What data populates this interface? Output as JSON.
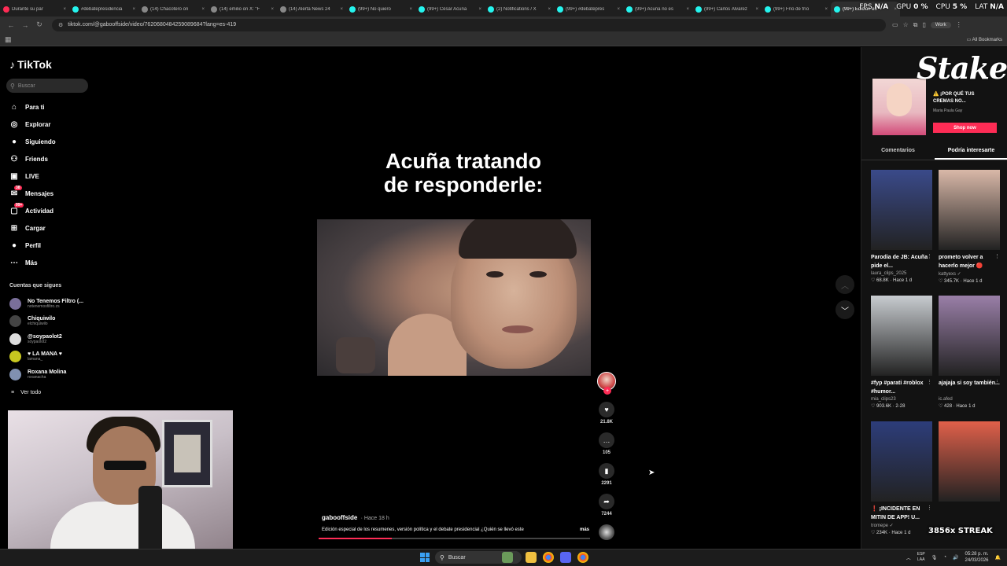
{
  "browser": {
    "tabs": [
      {
        "title": "Durante su par",
        "color": "#fe2c55",
        "icon": "youtube-icon"
      },
      {
        "title": "#debatepresidencia",
        "color": "#25f4ee",
        "icon": "tiktok-icon"
      },
      {
        "title": "(14) Chacotero on",
        "color": "#888888",
        "icon": "x-icon"
      },
      {
        "title": "(14) emilio on X: \"F",
        "color": "#888888",
        "icon": "x-icon"
      },
      {
        "title": "(14) Alerta News 24",
        "color": "#888888",
        "icon": "x-icon"
      },
      {
        "title": "(99+) No quiero",
        "color": "#25f4ee",
        "icon": "tiktok-icon"
      },
      {
        "title": "(99+) César Acuña",
        "color": "#25f4ee",
        "icon": "tiktok-icon"
      },
      {
        "title": "(2) Notifications / X",
        "color": "#25f4ee",
        "icon": "tiktok-icon"
      },
      {
        "title": "(99+) #debatepres",
        "color": "#25f4ee",
        "icon": "tiktok-icon"
      },
      {
        "title": "(99+) Acuña no es",
        "color": "#25f4ee",
        "icon": "tiktok-icon"
      },
      {
        "title": "(99+) Carlos Álvarez",
        "color": "#25f4ee",
        "icon": "tiktok-icon"
      },
      {
        "title": "(99+) Frío de frío",
        "color": "#25f4ee",
        "icon": "tiktok-icon"
      },
      {
        "title": "(99+) Edición es",
        "color": "#25f4ee",
        "icon": "tiktok-icon",
        "active": true
      }
    ],
    "url": "tiktok.com/@gabooffside/video/7620680484259089684?lang=es-419",
    "profile": "Work",
    "all_bookmarks": "All Bookmarks"
  },
  "hud": {
    "fps_label": "FPS",
    "fps_value": "N/A",
    "gpu_label": "GPU",
    "gpu_value": "0 %",
    "cpu_label": "CPU",
    "cpu_value": "5 %",
    "lat_label": "LAT",
    "lat_value": "N/A"
  },
  "sidebar": {
    "logo": "TikTok",
    "search_placeholder": "Buscar",
    "nav": [
      {
        "label": "Para ti",
        "icon": "home-icon",
        "glyph": "⌂"
      },
      {
        "label": "Explorar",
        "icon": "compass-icon",
        "glyph": "◎"
      },
      {
        "label": "Siguiendo",
        "icon": "following-icon",
        "glyph": "●"
      },
      {
        "label": "Friends",
        "icon": "friends-icon",
        "glyph": "⚇"
      },
      {
        "label": "LIVE",
        "icon": "live-icon",
        "glyph": "▣"
      },
      {
        "label": "Mensajes",
        "icon": "messages-icon",
        "glyph": "✉",
        "badge": "38"
      },
      {
        "label": "Actividad",
        "icon": "activity-icon",
        "glyph": "▢",
        "badge": "99+"
      },
      {
        "label": "Cargar",
        "icon": "upload-icon",
        "glyph": "⊞"
      },
      {
        "label": "Perfil",
        "icon": "profile-icon",
        "glyph": "●"
      },
      {
        "label": "Más",
        "icon": "more-icon",
        "glyph": "⋯"
      }
    ],
    "following_title": "Cuentas que sigues",
    "accounts": [
      {
        "name": "No Tenemos Filtro (...",
        "user": "notenemosfiltro.zs",
        "color": "#7a6f9a"
      },
      {
        "name": "Chiquiwilo",
        "user": "elchiquiwilo",
        "color": "#444444"
      },
      {
        "name": "@soypaolot2",
        "user": "soypaolot2",
        "color": "#dddddd"
      },
      {
        "name": "♥ LA MANA ♥",
        "user": "lamana_",
        "color": "#c8c820"
      },
      {
        "name": "Roxana Molina",
        "user": "roxanacha",
        "color": "#8090b0"
      }
    ],
    "see_all": "Ver todo"
  },
  "video": {
    "overlay_title_line1": "Acuña tratando",
    "overlay_title_line2": "de responderle:",
    "author": "gabooffside",
    "time": "· Hace 18 h",
    "description": "Edición especial de los resumenes, versión política y el debate presidencial ¿Quién se llevó este",
    "more": "más",
    "progress": 0.27,
    "actions": {
      "likes": "21.8K",
      "comments": "105",
      "saves": "2291",
      "shares": "7244"
    }
  },
  "right_panel": {
    "ad": {
      "title": "⚠️ ¡POR QUÉ TUS CREMAS NO...",
      "subtitle": "Maria Paula Gay",
      "button": "Shop now"
    },
    "brand_overlay": "Stake",
    "tabs": [
      "Comentarios",
      "Podría interesarte"
    ],
    "active_tab": 1,
    "cards": [
      {
        "title": "Parodia de JB: Acuña pide el...",
        "user": "laura_clips_2025",
        "stats": "♡ 68.8K · Hace 1 d",
        "thumb": "#3a4a8a"
      },
      {
        "title": "prometo volver a hacerlo mejor 🔴",
        "user": "kattyexs ✓",
        "stats": "♡ 345.7K · Hace 1 d",
        "thumb": "#d9b8a8"
      },
      {
        "title": "#fyp #parati #roblox #humor...",
        "user": "mia_clips23",
        "stats": "♡ 903.6K · 2-28",
        "thumb": "#c8ccd0"
      },
      {
        "title": "ajajaja si soy también...",
        "user": "ic.afed",
        "stats": "♡ 428 · Hace 1 d",
        "thumb": "#9a7fa8"
      },
      {
        "title": "❗ ¡INCIDENTE EN MITIN DE APP! U...",
        "user": "tromepe ✓",
        "stats": "♡ 234K · Hace 1 d",
        "thumb": "#2d3d7a"
      },
      {
        "title": "",
        "user": "",
        "stats": "",
        "thumb": "#e0604a"
      }
    ],
    "streak": "3856x STREAK"
  },
  "taskbar": {
    "search": "Buscar",
    "lang_line1": "ESP",
    "lang_line2": "LAA",
    "time": "05:28 p. m.",
    "date": "24/03/2026"
  }
}
